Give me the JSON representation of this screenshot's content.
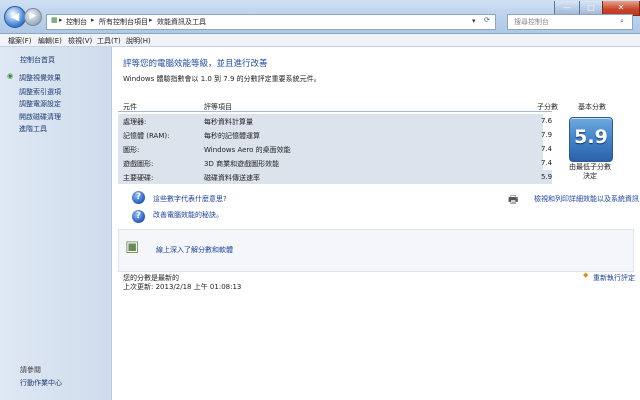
{
  "window": {
    "minimize": "—",
    "maximize": "□",
    "close": "✕"
  },
  "address": {
    "crumbs": [
      "控制台",
      "所有控制台項目",
      "效能資訊及工具"
    ],
    "separator": "▸"
  },
  "search": {
    "placeholder": "搜尋控制台"
  },
  "menu": [
    "檔案(F)",
    "編輯(E)",
    "檢視(V)",
    "工具(T)",
    "說明(H)"
  ],
  "sidebar": {
    "home": "控制台首頁",
    "items": [
      "調整視覺效果",
      "調整索引選項",
      "調整電源設定",
      "開啟磁碟清理",
      "進階工具"
    ],
    "see_also_title": "請參閱",
    "see_also": [
      "行動作業中心"
    ]
  },
  "main": {
    "title": "評等您的電腦效能等級，並且進行改善",
    "intro": "Windows 體驗指數會以 1.0 到 7.9 的分數評定重要系統元件。",
    "col_component": "元件",
    "col_rating": "評等項目",
    "col_subscore": "子分數",
    "col_base": "基本分數",
    "rows": [
      {
        "component": "處理器:",
        "what": "每秒資料計算量",
        "score": "7.6"
      },
      {
        "component": "記憶體 (RAM):",
        "what": "每秒的記憶體運算",
        "score": "7.9"
      },
      {
        "component": "圖形:",
        "what": "Windows Aero 的桌面效能",
        "score": "7.4"
      },
      {
        "component": "遊戲圖形:",
        "what": "3D 商業和遊戲圖形效能",
        "score": "7.4"
      },
      {
        "component": "主要硬碟:",
        "what": "磁碟資料傳送速率",
        "score": "5.9"
      }
    ],
    "base_score": "5.9",
    "base_caption": "由最低子分數決定",
    "help_links": [
      "這些數字代表什麼意思?",
      "改善電腦效能的秘訣。"
    ],
    "print_link": "檢視和列印詳細效能以及系統資訊",
    "learn_more": "線上深入了解分數和軟體",
    "current_status": "您的分數是最新的",
    "last_update": "上次更新: 2013/2/18 上午 01:08:13",
    "rerun": "重新執行評定"
  }
}
